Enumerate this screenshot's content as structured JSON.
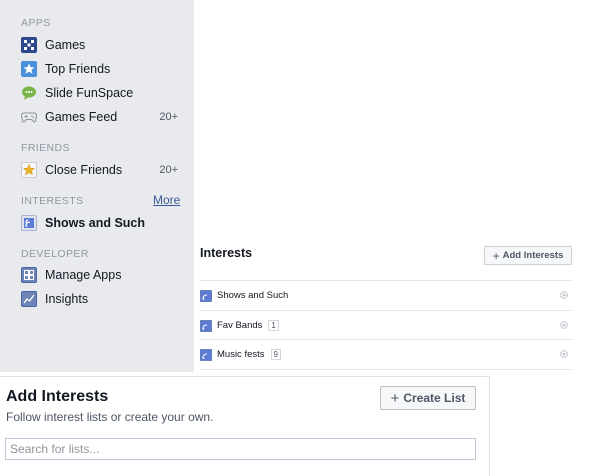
{
  "sidebar": {
    "sections": {
      "apps": "APPS",
      "friends": "FRIENDS",
      "interests": "INTERESTS",
      "developer": "DEVELOPER"
    },
    "apps": [
      {
        "label": "Games",
        "icon": "games-icon",
        "count": ""
      },
      {
        "label": "Top Friends",
        "icon": "star-icon",
        "count": ""
      },
      {
        "label": "Slide FunSpace",
        "icon": "speech-bubble-icon",
        "count": ""
      },
      {
        "label": "Games Feed",
        "icon": "gamepad-icon",
        "count": "20+"
      }
    ],
    "friends": [
      {
        "label": "Close Friends",
        "icon": "star-icon",
        "count": "20+"
      }
    ],
    "interests_more": "More",
    "interests": [
      {
        "label": "Shows and Such",
        "icon": "interest-list-icon"
      }
    ],
    "developer": [
      {
        "label": "Manage Apps",
        "icon": "apps-icon"
      },
      {
        "label": "Insights",
        "icon": "insights-icon"
      }
    ]
  },
  "interests_panel": {
    "title": "Interests",
    "add_button": "Add Interests",
    "items": [
      {
        "name": "Shows and Such",
        "badge": ""
      },
      {
        "name": "Fav Bands",
        "badge": "1"
      },
      {
        "name": "Music fests",
        "badge": "9"
      }
    ]
  },
  "dialog": {
    "title": "Add Interests",
    "subtitle": "Follow interest lists or create your own.",
    "create_button": "Create List",
    "search_placeholder": "Search for lists..."
  },
  "colors": {
    "sidebar_bg": "#e9eaed",
    "link": "#3b5998",
    "muted": "#9197a3"
  }
}
